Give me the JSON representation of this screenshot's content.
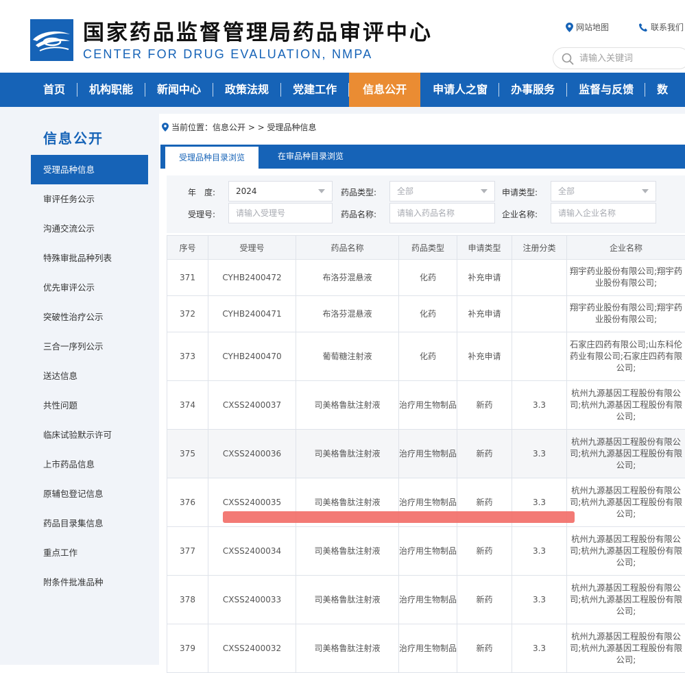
{
  "header": {
    "title": "国家药品监督管理局药品审评中心",
    "subtitle": "CENTER FOR DRUG EVALUATION, NMPA",
    "sitemap": "网站地图",
    "contact": "联系我们",
    "search_placeholder": "请输入关键词"
  },
  "nav": [
    "首页",
    "机构职能",
    "新闻中心",
    "政策法规",
    "党建工作",
    "信息公开",
    "申请人之窗",
    "办事服务",
    "监督与反馈",
    "数"
  ],
  "sidebar": {
    "title": "信息公开",
    "items": [
      "受理品种信息",
      "审评任务公示",
      "沟通交流公示",
      "特殊审批品种列表",
      "优先审评公示",
      "突破性治疗公示",
      "三合一序列公示",
      "送达信息",
      "共性问题",
      "临床试验默示许可",
      "上市药品信息",
      "原辅包登记信息",
      "药品目录集信息",
      "重点工作",
      "附条件批准品种"
    ]
  },
  "breadcrumb": "当前位置：信息公开 > > 受理品种信息",
  "tabs": [
    "受理品种目录浏览",
    "在审品种目录浏览"
  ],
  "filters": {
    "year_label": "年　度:",
    "year_value": "2024",
    "drug_type_label": "药品类型:",
    "drug_type_value": "全部",
    "app_type_label": "申请类型:",
    "app_type_value": "全部",
    "accept_no_label": "受理号:",
    "accept_no_placeholder": "请输入受理号",
    "drug_name_label": "药品名称:",
    "drug_name_placeholder": "请输入药品名称",
    "company_label": "企业名称:",
    "company_placeholder": "请输入企业名称"
  },
  "table": {
    "headers": [
      "序号",
      "受理号",
      "药品名称",
      "药品类型",
      "申请类型",
      "注册分类",
      "企业名称"
    ],
    "rows": [
      {
        "no": "371",
        "id": "CYHB2400472",
        "name": "布洛芬混悬液",
        "type": "化药",
        "app": "补充申请",
        "cls": "",
        "company": "翔宇药业股份有限公司;翔宇药业股份有限公司;"
      },
      {
        "no": "372",
        "id": "CYHB2400471",
        "name": "布洛芬混悬液",
        "type": "化药",
        "app": "补充申请",
        "cls": "",
        "company": "翔宇药业股份有限公司;翔宇药业股份有限公司;"
      },
      {
        "no": "373",
        "id": "CYHB2400470",
        "name": "葡萄糖注射液",
        "type": "化药",
        "app": "补充申请",
        "cls": "",
        "company": "石家庄四药有限公司;山东科伦药业有限公司;石家庄四药有限公司;"
      },
      {
        "no": "374",
        "id": "CXSS2400037",
        "name": "司美格鲁肽注射液",
        "type": "治疗用生物制品",
        "app": "新药",
        "cls": "3.3",
        "company": "杭州九源基因工程股份有限公司;杭州九源基因工程股份有限公司;"
      },
      {
        "no": "375",
        "id": "CXSS2400036",
        "name": "司美格鲁肽注射液",
        "type": "治疗用生物制品",
        "app": "新药",
        "cls": "3.3",
        "company": "杭州九源基因工程股份有限公司;杭州九源基因工程股份有限公司;"
      },
      {
        "no": "376",
        "id": "CXSS2400035",
        "name": "司美格鲁肽注射液",
        "type": "治疗用生物制品",
        "app": "新药",
        "cls": "3.3",
        "company": "杭州九源基因工程股份有限公司;杭州九源基因工程股份有限公司;"
      },
      {
        "no": "377",
        "id": "CXSS2400034",
        "name": "司美格鲁肽注射液",
        "type": "治疗用生物制品",
        "app": "新药",
        "cls": "3.3",
        "company": "杭州九源基因工程股份有限公司;杭州九源基因工程股份有限公司;"
      },
      {
        "no": "378",
        "id": "CXSS2400033",
        "name": "司美格鲁肽注射液",
        "type": "治疗用生物制品",
        "app": "新药",
        "cls": "3.3",
        "company": "杭州九源基因工程股份有限公司;杭州九源基因工程股份有限公司;"
      },
      {
        "no": "379",
        "id": "CXSS2400032",
        "name": "司美格鲁肽注射液",
        "type": "治疗用生物制品",
        "app": "新药",
        "cls": "3.3",
        "company": "杭州九源基因工程股份有限公司;杭州九源基因工程股份有限公司;"
      }
    ]
  },
  "colors": {
    "brand": "#1663b7",
    "active_nav": "#ea8c33",
    "highlight_mark": "#f26b66"
  }
}
